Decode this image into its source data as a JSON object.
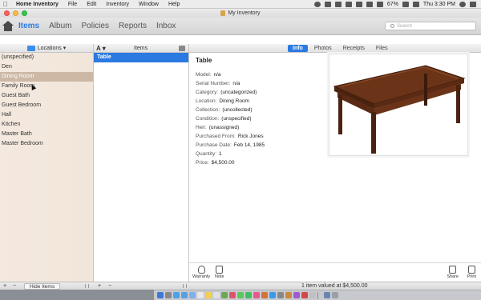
{
  "menubar": {
    "app_name": "Home Inventory",
    "menus": [
      "File",
      "Edit",
      "Inventory",
      "Window",
      "Help"
    ],
    "battery": "67%",
    "clock": "Thu 3:30 PM"
  },
  "window": {
    "title": "My Inventory"
  },
  "toolbar": {
    "tabs": [
      "Items",
      "Album",
      "Policies",
      "Reports",
      "Inbox"
    ],
    "active_tab": "Items",
    "search_placeholder": "Search"
  },
  "locations": {
    "header": "Locations ▾",
    "items": [
      "(unspecified)",
      "Den",
      "Dining Room",
      "Family Room",
      "Guest Bath",
      "Guest Bedroom",
      "Hall",
      "Kitchen",
      "Master Bath",
      "Master Bedroom"
    ],
    "selected": "Dining Room"
  },
  "items_list": {
    "sort_label": "A ▾",
    "header": "Items",
    "items": [
      "Table"
    ],
    "selected": "Table"
  },
  "detail": {
    "tabs": [
      "Info",
      "Photos",
      "Receipts",
      "Files"
    ],
    "active_tab": "Info",
    "title": "Table",
    "fields": [
      {
        "label": "Model:",
        "value": "n/a"
      },
      {
        "label": "Serial Number:",
        "value": "n/a"
      },
      {
        "label": "Category:",
        "value": "(uncategorized)"
      },
      {
        "label": "Location:",
        "value": "Dining Room"
      },
      {
        "label": "Collection:",
        "value": "(uncollected)"
      },
      {
        "label": "Condition:",
        "value": "(unspecified)"
      },
      {
        "label": "Heir:",
        "value": "(unassigned)"
      },
      {
        "label": "Purchased From:",
        "value": "Rick Jones"
      },
      {
        "label": "Purchase Date:",
        "value": "Feb 14, 1985"
      },
      {
        "label": "Quantity:",
        "value": "1"
      },
      {
        "label": "Price:",
        "value": "$4,500.00"
      }
    ]
  },
  "actions": {
    "warranty": "Warranty",
    "note": "Note",
    "share": "Share",
    "print": "Print"
  },
  "statusbar": {
    "plus": "+",
    "minus": "−",
    "hide_items": "Hide Items",
    "summary": "1 item valued at $4,500.00"
  },
  "colors": {
    "accent": "#2a7ae2",
    "location_selected": "#cdb8a5",
    "sidebar_bg": "#f4e9df"
  }
}
